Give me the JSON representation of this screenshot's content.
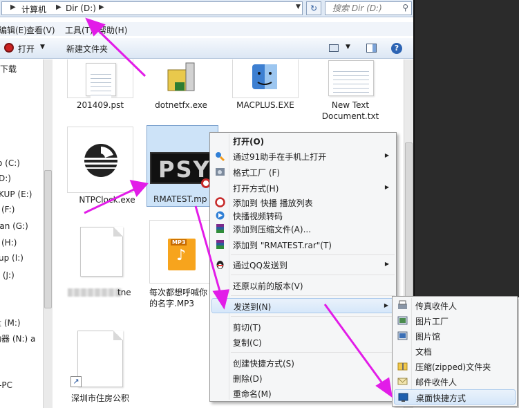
{
  "address": {
    "segments": [
      "计算机",
      "Dir (D:)"
    ],
    "search_placeholder": "搜索 Dir (D:)"
  },
  "menu": [
    "编辑(E)",
    "查看(V)",
    "工具(T)",
    "帮助(H)"
  ],
  "toolbar": {
    "open_label": "打开",
    "new_folder_label": "新建文件夹",
    "help_label": "?"
  },
  "sidebar": {
    "items": [
      "下载",
      "o (C:)",
      "D:)",
      "KUP (E:)",
      "(F:)",
      "ian (G:)",
      "(H:)",
      "up (I:)",
      "盘 (J:)",
      "盘 (M:)",
      "动器 (N:) a",
      "-PC"
    ]
  },
  "files": [
    {
      "name": "201409.pst"
    },
    {
      "name": "dotnetfx.exe"
    },
    {
      "name": "MACPLUS.EXE"
    },
    {
      "name": "New Text Document.txt"
    },
    {
      "name": "NTPClock.exe"
    },
    {
      "name": "RMATEST.mp"
    },
    {
      "name": "tne"
    },
    {
      "name": "每次都想呼喊你的名字.MP3"
    },
    {
      "name": "深圳市住房公积"
    }
  ],
  "thumbnails": {
    "psy_text": "PSY",
    "mp3_text": "MP3"
  },
  "context_menu": {
    "items": [
      {
        "label": "打开(O)",
        "bold": true
      },
      {
        "label": "通过91助手在手机上打开",
        "submenu": true
      },
      {
        "label": "格式工厂 (F)"
      },
      {
        "label": "打开方式(H)",
        "submenu": true
      },
      {
        "label": "添加到 快播 播放列表"
      },
      {
        "label": "快播视频转码"
      },
      {
        "label": "添加到压缩文件(A)..."
      },
      {
        "label": "添加到 \"RMATEST.rar\"(T)"
      },
      {
        "label": "通过QQ发送到",
        "submenu": true
      },
      {
        "label": "还原以前的版本(V)"
      },
      {
        "label": "发送到(N)",
        "submenu": true,
        "highlight": true
      },
      {
        "label": "剪切(T)"
      },
      {
        "label": "复制(C)"
      },
      {
        "label": "创建快捷方式(S)"
      },
      {
        "label": "删除(D)"
      },
      {
        "label": "重命名(M)"
      }
    ]
  },
  "send_to_menu": {
    "items": [
      "传真收件人",
      "图片工厂",
      "图片馆",
      "文档",
      "压缩(zipped)文件夹",
      "邮件收件人",
      "桌面快捷方式"
    ]
  },
  "colors": {
    "arrow": "#e21ce8",
    "selection": "#cde3f8",
    "menu_highlight": "#d6e7fa"
  }
}
